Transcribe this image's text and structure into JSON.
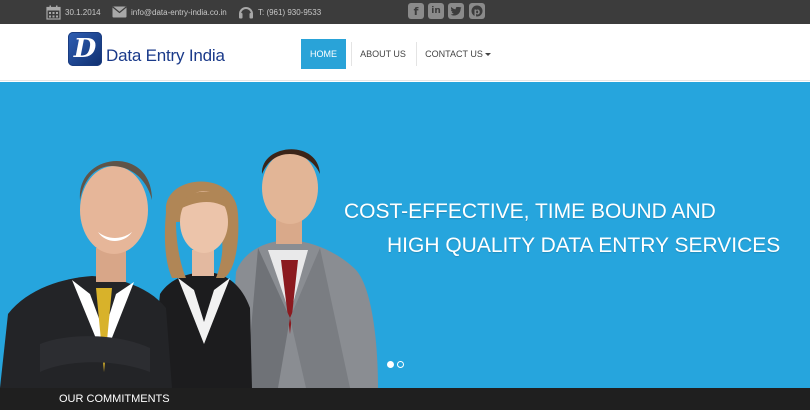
{
  "topbar": {
    "date": "30.1.2014",
    "email": "info@data-entry-india.co.in",
    "phone": "T: (961) 930-9533",
    "social_icons": [
      "facebook-icon",
      "linkedin-icon",
      "twitter-icon",
      "pinterest-icon"
    ]
  },
  "header": {
    "logo_letter": "D",
    "site_name": "Data Entry India",
    "nav": {
      "home": "HOME",
      "about": "ABOUT US",
      "contact": "CONTACT US"
    }
  },
  "hero": {
    "line1": "COST-EFFECTIVE, TIME BOUND AND",
    "line2": "HIGH QUALITY DATA ENTRY SERVICES",
    "slides": 2,
    "active_slide": 1
  },
  "commitments": {
    "title": "OUR COMMITMENTS"
  },
  "colors": {
    "topbar": "#3c3c3c",
    "accent": "#29a3d8",
    "hero": "#26a5dd",
    "logo_text": "#1a3a8a",
    "footer_strip": "#1f1f1f"
  }
}
